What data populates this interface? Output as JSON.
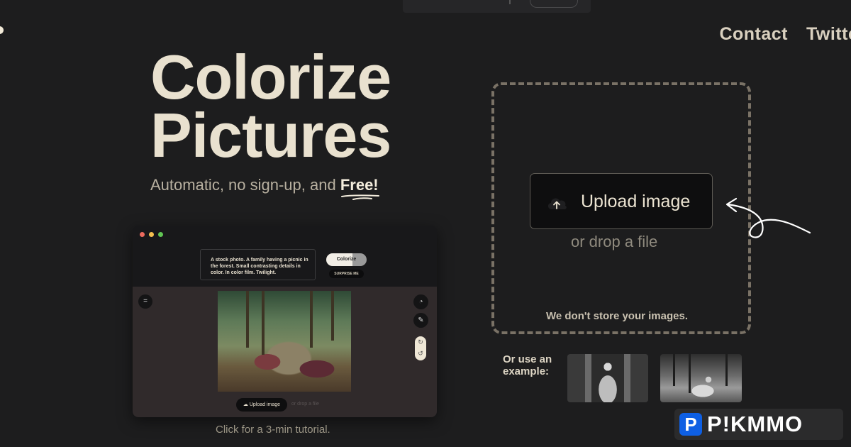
{
  "nav": {
    "contact": "Contact",
    "twitter": "Twitter"
  },
  "hero": {
    "title_line1": "Colorize",
    "title_line2": "Pictures",
    "subtitle_prefix": "Automatic, no sign-up, and ",
    "subtitle_highlight": "Free!"
  },
  "demo": {
    "window_dot_colors": [
      "#ec6a5e",
      "#f4bf4f",
      "#61c554"
    ],
    "prompt_text": "A stock photo. A family having a picnic in the forest. Small contrasting details in color. In color film. Twilight.",
    "colorize_label": "Colorize",
    "surprise_label": "SURPRISE ME",
    "upload_label": "Upload image",
    "drop_label": "or drop a file"
  },
  "tutorial_text": "Click for a 3-min tutorial.",
  "upload": {
    "button_label": "Upload image",
    "drop_text": "or drop a file",
    "privacy_text": "We don't store your images."
  },
  "examples": {
    "label_line1": "Or use an",
    "label_line2": "example:"
  },
  "watermark": {
    "icon_letter": "P",
    "brand": "P!KMMO"
  },
  "colors": {
    "background": "#1d1d1e",
    "cream": "#e9e1cf",
    "dashed_border": "#7a7266",
    "watermark_blue": "#0e5fe3"
  }
}
